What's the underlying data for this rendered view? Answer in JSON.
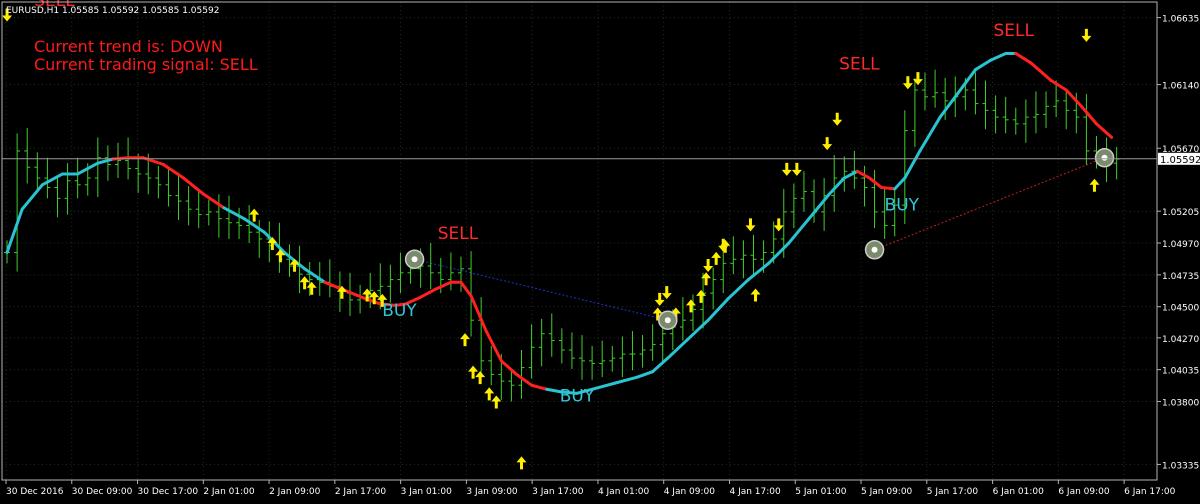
{
  "header": {
    "symbol_ohlc": "EURUSD,H1  1.05585 1.05592 1.05585 1.05592",
    "trend_text": "Current trend is: DOWN",
    "signal_text": "Current trading signal: SELL"
  },
  "colors": {
    "background": "#000000",
    "frame": "#b4b4b4",
    "grid": "#1f2e1f",
    "axis_text": "#ffffff",
    "candles": "#3fcf2a",
    "ma_up": "#29c4d1",
    "ma_down": "#ff2020",
    "arrows": "#ffee00",
    "info_text": "#ff1a1a",
    "buy_label": "#33c6d8",
    "sell_label": "#ff2a2a",
    "price_line": "#c0c0c0",
    "trade_line_blue": "#2030d0",
    "trade_line_red": "#c02020"
  },
  "chart_data": {
    "type": "line",
    "title": "EURUSD,H1",
    "ylim": [
      1.0322,
      1.0675
    ],
    "y_ticks": [
      "1.06635",
      "1.06140",
      "1.05670",
      "1.05205",
      "1.04970",
      "1.04735",
      "1.04500",
      "1.04270",
      "1.04035",
      "1.03800",
      "1.03335"
    ],
    "x_ticks": [
      "30 Dec 2016",
      "30 Dec 09:00",
      "30 Dec 17:00",
      "2 Jan 01:00",
      "2 Jan 09:00",
      "2 Jan 17:00",
      "3 Jan 01:00",
      "3 Jan 09:00",
      "3 Jan 17:00",
      "4 Jan 01:00",
      "4 Jan 09:00",
      "4 Jan 17:00",
      "5 Jan 01:00",
      "5 Jan 09:00",
      "5 Jan 17:00",
      "6 Jan 01:00",
      "6 Jan 09:00",
      "6 Jan 17:00"
    ],
    "current_price": "1.05592",
    "x_domain": [
      0,
      1145
    ],
    "close_series": [
      [
        5,
        1.049
      ],
      [
        15,
        1.0565
      ],
      [
        25,
        1.0553
      ],
      [
        35,
        1.0545
      ],
      [
        45,
        1.0538
      ],
      [
        55,
        1.053
      ],
      [
        65,
        1.0543
      ],
      [
        75,
        1.054
      ],
      [
        85,
        1.0545
      ],
      [
        95,
        1.056
      ],
      [
        105,
        1.0555
      ],
      [
        115,
        1.0558
      ],
      [
        125,
        1.0552
      ],
      [
        135,
        1.0548
      ],
      [
        145,
        1.0545
      ],
      [
        155,
        1.054
      ],
      [
        165,
        1.0532
      ],
      [
        175,
        1.0528
      ],
      [
        185,
        1.0522
      ],
      [
        195,
        1.0518
      ],
      [
        205,
        1.052
      ],
      [
        215,
        1.0515
      ],
      [
        225,
        1.0512
      ],
      [
        235,
        1.051
      ],
      [
        245,
        1.0505
      ],
      [
        255,
        1.05
      ],
      [
        265,
        1.0495
      ],
      [
        275,
        1.0485
      ],
      [
        285,
        1.048
      ],
      [
        295,
        1.0474
      ],
      [
        305,
        1.047
      ],
      [
        315,
        1.0468
      ],
      [
        325,
        1.0465
      ],
      [
        335,
        1.046
      ],
      [
        345,
        1.0455
      ],
      [
        355,
        1.0457
      ],
      [
        365,
        1.0462
      ],
      [
        375,
        1.0465
      ],
      [
        385,
        1.047
      ],
      [
        395,
        1.0475
      ],
      [
        405,
        1.0478
      ],
      [
        415,
        1.048
      ],
      [
        425,
        1.0475
      ],
      [
        435,
        1.047
      ],
      [
        445,
        1.0475
      ],
      [
        455,
        1.0478
      ],
      [
        465,
        1.044
      ],
      [
        475,
        1.041
      ],
      [
        485,
        1.04
      ],
      [
        495,
        1.0395
      ],
      [
        505,
        1.0392
      ],
      [
        515,
        1.0405
      ],
      [
        525,
        1.042
      ],
      [
        535,
        1.043
      ],
      [
        545,
        1.0425
      ],
      [
        555,
        1.0418
      ],
      [
        565,
        1.0412
      ],
      [
        575,
        1.041
      ],
      [
        585,
        1.0408
      ],
      [
        595,
        1.041
      ],
      [
        605,
        1.0412
      ],
      [
        615,
        1.0415
      ],
      [
        625,
        1.0415
      ],
      [
        635,
        1.0418
      ],
      [
        645,
        1.0422
      ],
      [
        655,
        1.043
      ],
      [
        665,
        1.0435
      ],
      [
        675,
        1.044
      ],
      [
        685,
        1.0448
      ],
      [
        695,
        1.046
      ],
      [
        705,
        1.047
      ],
      [
        715,
        1.0482
      ],
      [
        725,
        1.0485
      ],
      [
        735,
        1.0488
      ],
      [
        745,
        1.0485
      ],
      [
        755,
        1.049
      ],
      [
        765,
        1.05
      ],
      [
        775,
        1.052
      ],
      [
        785,
        1.053
      ],
      [
        795,
        1.0535
      ],
      [
        805,
        1.052
      ],
      [
        815,
        1.0532
      ],
      [
        825,
        1.0545
      ],
      [
        835,
        1.055
      ],
      [
        845,
        1.0545
      ],
      [
        855,
        1.0538
      ],
      [
        865,
        1.052
      ],
      [
        875,
        1.051
      ],
      [
        885,
        1.0525
      ],
      [
        895,
        1.058
      ],
      [
        905,
        1.061
      ],
      [
        915,
        1.0605
      ],
      [
        925,
        1.0608
      ],
      [
        935,
        1.0602
      ],
      [
        945,
        1.0605
      ],
      [
        955,
        1.061
      ],
      [
        965,
        1.06
      ],
      [
        975,
        1.0595
      ],
      [
        985,
        1.059
      ],
      [
        995,
        1.0588
      ],
      [
        1005,
        1.0585
      ],
      [
        1015,
        1.059
      ],
      [
        1025,
        1.0592
      ],
      [
        1035,
        1.0598
      ],
      [
        1045,
        1.0602
      ],
      [
        1055,
        1.0595
      ],
      [
        1065,
        1.059
      ],
      [
        1075,
        1.0565
      ],
      [
        1085,
        1.056
      ],
      [
        1095,
        1.0556
      ],
      [
        1105,
        1.0559
      ]
    ],
    "ma_series": [
      [
        5,
        1.049
      ],
      [
        20,
        1.0522
      ],
      [
        40,
        1.054
      ],
      [
        60,
        1.0548
      ],
      [
        75,
        1.0548
      ],
      [
        95,
        1.0556
      ],
      [
        110,
        1.0559
      ],
      [
        125,
        1.056
      ],
      [
        140,
        1.056
      ],
      [
        160,
        1.0555
      ],
      [
        180,
        1.0545
      ],
      [
        200,
        1.0533
      ],
      [
        220,
        1.0523
      ],
      [
        240,
        1.0515
      ],
      [
        260,
        1.0505
      ],
      [
        280,
        1.049
      ],
      [
        300,
        1.0478
      ],
      [
        320,
        1.0468
      ],
      [
        340,
        1.0462
      ],
      [
        360,
        1.0456
      ],
      [
        375,
        1.0452
      ],
      [
        390,
        1.0451
      ],
      [
        400,
        1.0452
      ],
      [
        415,
        1.0457
      ],
      [
        430,
        1.0463
      ],
      [
        445,
        1.0468
      ],
      [
        455,
        1.0468
      ],
      [
        465,
        1.0458
      ],
      [
        480,
        1.0432
      ],
      [
        495,
        1.041
      ],
      [
        510,
        1.04
      ],
      [
        525,
        1.0392
      ],
      [
        540,
        1.0389
      ],
      [
        555,
        1.0387
      ],
      [
        570,
        1.0386
      ],
      [
        590,
        1.039
      ],
      [
        610,
        1.0394
      ],
      [
        630,
        1.0398
      ],
      [
        645,
        1.0402
      ],
      [
        660,
        1.0412
      ],
      [
        680,
        1.0426
      ],
      [
        700,
        1.044
      ],
      [
        720,
        1.0456
      ],
      [
        740,
        1.047
      ],
      [
        760,
        1.0482
      ],
      [
        780,
        1.0497
      ],
      [
        800,
        1.0515
      ],
      [
        820,
        1.0533
      ],
      [
        835,
        1.0545
      ],
      [
        848,
        1.055
      ],
      [
        860,
        1.0545
      ],
      [
        872,
        1.0538
      ],
      [
        885,
        1.0537
      ],
      [
        895,
        1.0545
      ],
      [
        910,
        1.0565
      ],
      [
        930,
        1.059
      ],
      [
        950,
        1.061
      ],
      [
        965,
        1.0625
      ],
      [
        980,
        1.0632
      ],
      [
        995,
        1.0637
      ],
      [
        1005,
        1.0637
      ],
      [
        1020,
        1.063
      ],
      [
        1040,
        1.0617
      ],
      [
        1055,
        1.061
      ],
      [
        1070,
        1.0598
      ],
      [
        1085,
        1.0585
      ],
      [
        1100,
        1.0575
      ]
    ],
    "ma_down_ranges": [
      [
        110,
        210
      ],
      [
        330,
        455
      ],
      [
        455,
        545
      ],
      [
        848,
        885
      ],
      [
        1005,
        1100
      ]
    ],
    "signal_up_arrows": [
      [
        250,
        1.0518
      ],
      [
        268,
        1.0497
      ],
      [
        276,
        1.0488
      ],
      [
        290,
        1.0481
      ],
      [
        300,
        1.0468
      ],
      [
        307,
        1.0464
      ],
      [
        337,
        1.0461
      ],
      [
        362,
        1.0459
      ],
      [
        369,
        1.0457
      ],
      [
        377,
        1.0455
      ],
      [
        459,
        1.0426
      ],
      [
        467,
        1.0402
      ],
      [
        474,
        1.0398
      ],
      [
        483,
        1.0386
      ],
      [
        490,
        1.038
      ],
      [
        515,
        1.0335
      ],
      [
        650,
        1.0445
      ],
      [
        668,
        1.0445
      ],
      [
        683,
        1.0451
      ],
      [
        693,
        1.0458
      ],
      [
        698,
        1.0471
      ],
      [
        708,
        1.0486
      ],
      [
        717,
        1.0495
      ],
      [
        747,
        1.0459
      ],
      [
        1083,
        1.054
      ]
    ],
    "signal_down_arrows": [
      [
        5,
        1.0665
      ],
      [
        652,
        1.0455
      ],
      [
        659,
        1.046
      ],
      [
        700,
        1.048
      ],
      [
        715,
        1.0495
      ],
      [
        742,
        1.051
      ],
      [
        770,
        1.051
      ],
      [
        778,
        1.0551
      ],
      [
        788,
        1.0551
      ],
      [
        818,
        1.057
      ],
      [
        828,
        1.0588
      ],
      [
        898,
        1.0615
      ],
      [
        908,
        1.0618
      ],
      [
        1075,
        1.065
      ]
    ],
    "trade_markers": [
      [
        409,
        1.0485
      ],
      [
        660,
        1.044
      ],
      [
        865,
        1.0492
      ],
      [
        1093,
        1.056
      ]
    ],
    "labels": [
      {
        "text": "SELL",
        "x": 452,
        "y": 1.05,
        "signal": "sell"
      },
      {
        "text": "BUY",
        "x": 394,
        "y": 1.0443,
        "signal": "buy"
      },
      {
        "text": "BUY",
        "x": 570,
        "y": 1.038,
        "signal": "buy"
      },
      {
        "text": "SELL",
        "x": 850,
        "y": 1.0625,
        "signal": "sell"
      },
      {
        "text": "BUY",
        "x": 892,
        "y": 1.0521,
        "signal": "buy"
      },
      {
        "text": "SELL",
        "x": 1003,
        "y": 1.065,
        "signal": "sell"
      },
      {
        "text": "SELL",
        "x": 52,
        "y": 1.0672,
        "signal": "sell"
      }
    ],
    "trade_lines": [
      {
        "from": [
          409,
          1.0485
        ],
        "to": [
          660,
          1.044
        ],
        "style": "blue"
      },
      {
        "from": [
          865,
          1.0492
        ],
        "to": [
          1093,
          1.056
        ],
        "style": "red"
      }
    ],
    "grid": true
  }
}
